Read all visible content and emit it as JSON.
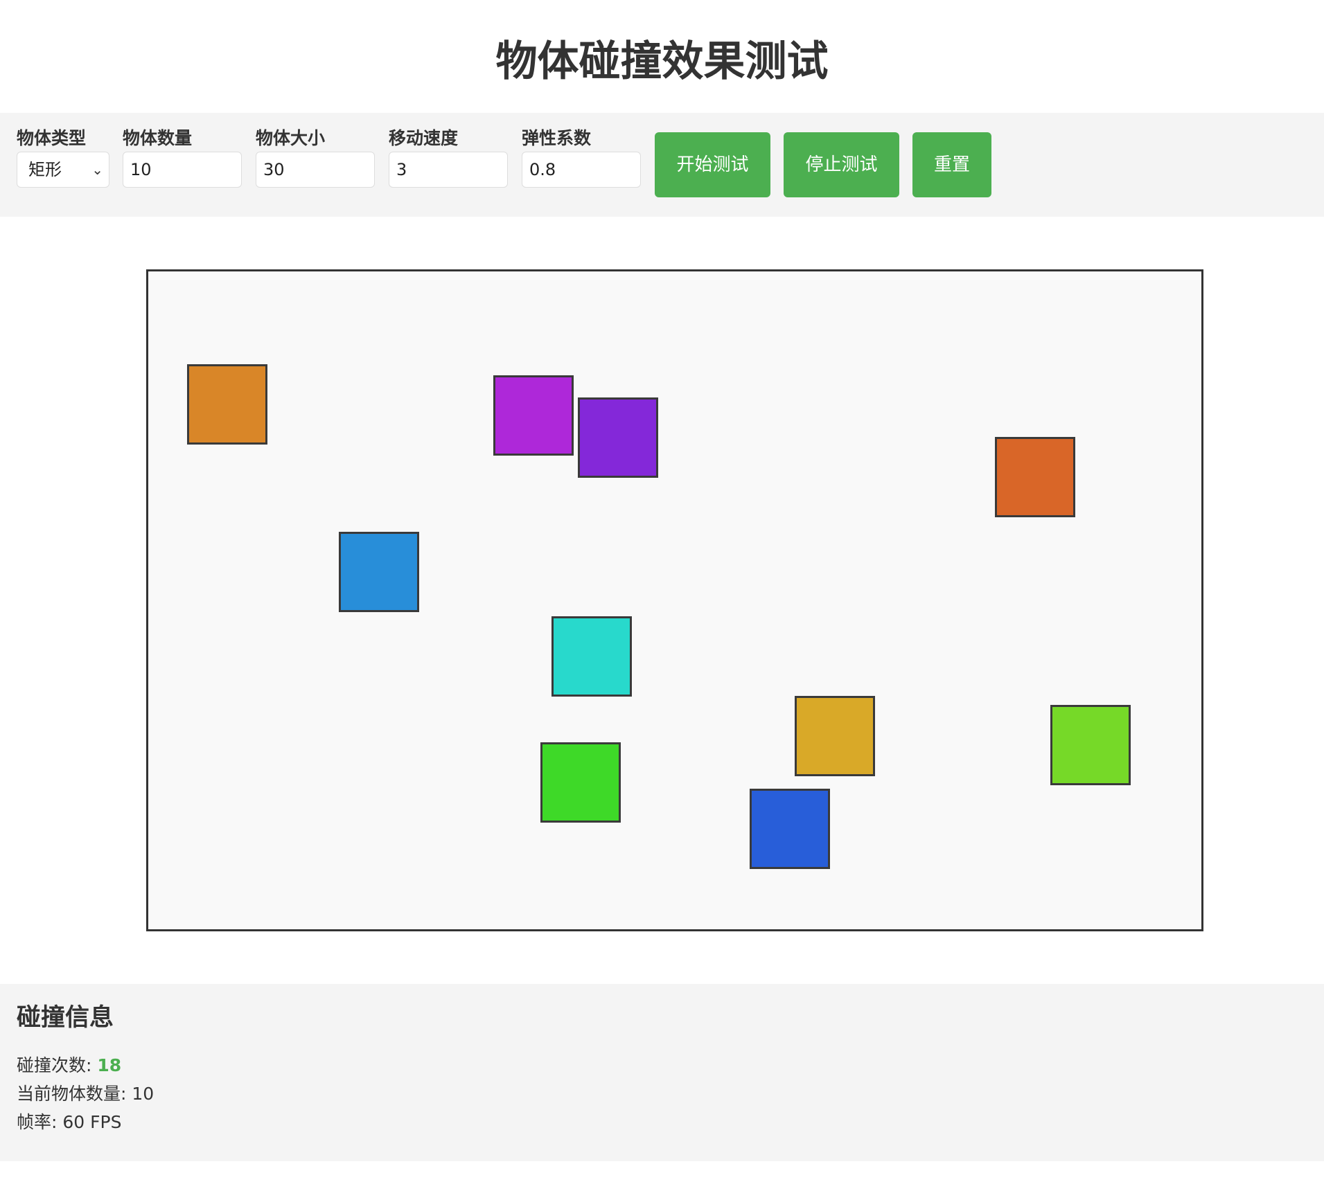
{
  "page": {
    "title": "物体碰撞效果测试"
  },
  "controls": {
    "type_label": "物体类型",
    "type_value": "矩形",
    "count_label": "物体数量",
    "count_value": "10",
    "size_label": "物体大小",
    "size_value": "30",
    "speed_label": "移动速度",
    "speed_value": "3",
    "elasticity_label": "弹性系数",
    "elasticity_value": "0.8",
    "start_label": "开始测试",
    "stop_label": "停止测试",
    "reset_label": "重置",
    "button_color": "#4caf50"
  },
  "canvas": {
    "background": "#f9f9f9",
    "objects": [
      {
        "color": "#d98628"
      },
      {
        "color": "#ae28d9"
      },
      {
        "color": "#8428d9"
      },
      {
        "color": "#d96628"
      },
      {
        "color": "#288ed9"
      },
      {
        "color": "#28d9cc"
      },
      {
        "color": "#d9a928"
      },
      {
        "color": "#76d928"
      },
      {
        "color": "#3ed928"
      },
      {
        "color": "#285ed9"
      }
    ]
  },
  "info": {
    "title": "碰撞信息",
    "collisions_label": "碰撞次数: ",
    "collisions_value": "18",
    "count_label": "当前物体数量: ",
    "count_value": "10",
    "fps_label": "帧率: ",
    "fps_value": "60 FPS"
  }
}
